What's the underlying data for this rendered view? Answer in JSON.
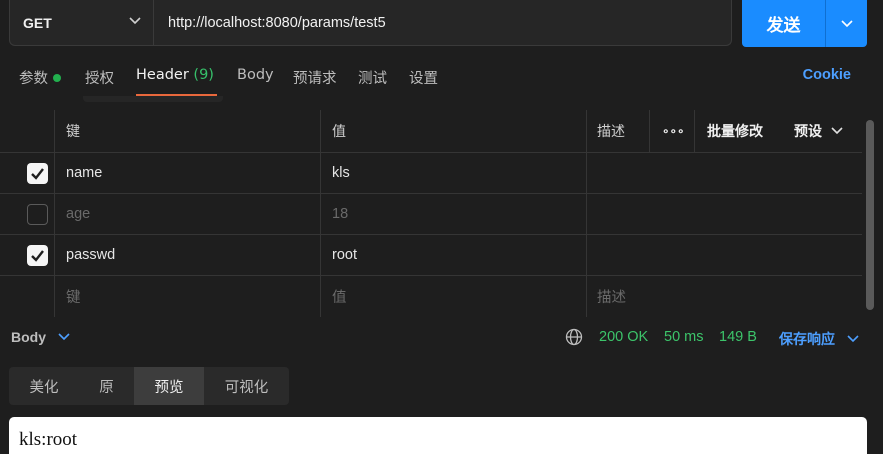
{
  "request": {
    "method": "GET",
    "url": "http://localhost:8080/params/test5",
    "send_label": "发送"
  },
  "tabs": {
    "params": "参数",
    "auth": "授权",
    "header": "Header",
    "header_count": "(9)",
    "body": "Body",
    "pre_request": "预请求",
    "test": "测试",
    "settings": "设置",
    "cookie": "Cookie"
  },
  "table": {
    "headers": {
      "key": "键",
      "value": "值",
      "description": "描述",
      "more": "∘∘∘",
      "bulk_edit": "批量修改",
      "preset": "预设"
    },
    "rows": [
      {
        "checked": true,
        "key": "name",
        "value": "kls",
        "description": ""
      },
      {
        "checked": false,
        "key": "age",
        "value": "18",
        "description": ""
      },
      {
        "checked": true,
        "key": "passwd",
        "value": "root",
        "description": ""
      }
    ],
    "placeholders": {
      "key": "键",
      "value": "值",
      "description": "描述"
    }
  },
  "response": {
    "body_label": "Body",
    "status": "200 OK",
    "time": "50 ms",
    "size": "149 B",
    "save_label": "保存响应",
    "view_tabs": [
      "美化",
      "原",
      "预览",
      "可视化"
    ],
    "active_view": "预览",
    "preview_text": "kls:root"
  },
  "colors": {
    "accent": "#1a8cff",
    "status_ok": "#3cc46a",
    "tab_underline": "#e9683c"
  }
}
